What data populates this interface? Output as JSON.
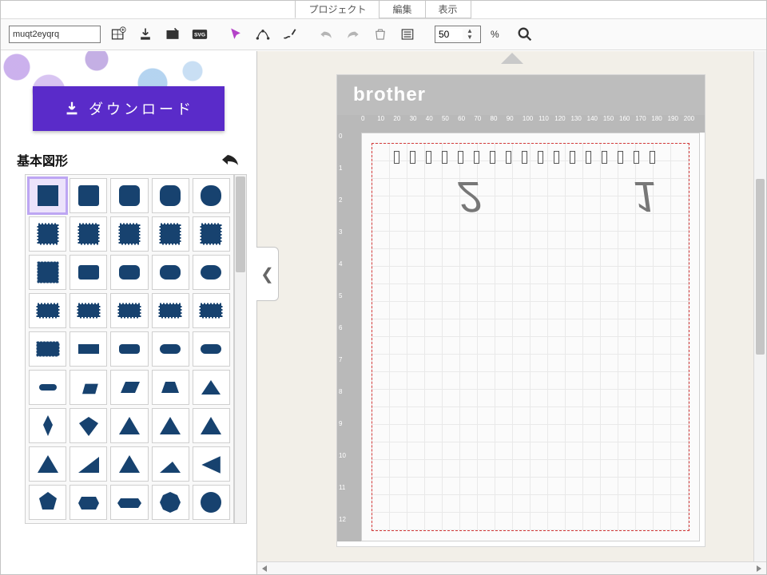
{
  "menu": {
    "project": "プロジェクト",
    "edit": "編集",
    "view": "表示"
  },
  "toolbar": {
    "searchValue": "muqt2eyqrq",
    "zoom": "50",
    "percent": "%",
    "icons": {
      "grid": "grid-plus-icon",
      "import": "import-icon",
      "image": "image-icon",
      "svg": "SVG",
      "pointer": "pointer-icon",
      "path": "path-icon",
      "draw": "draw-icon",
      "undo": "undo-icon",
      "redo": "redo-icon",
      "trash": "trash-icon",
      "panel": "panel-icon",
      "search": "search-icon"
    }
  },
  "left": {
    "download": "ダウンロード",
    "shapesTitle": "基本図形"
  },
  "mat": {
    "brand": "brother",
    "rulerTop": [
      "0",
      "10",
      "20",
      "30",
      "40",
      "50",
      "60",
      "70",
      "80",
      "90",
      "100",
      "110",
      "120",
      "130",
      "140",
      "150",
      "160",
      "170",
      "180",
      "190",
      "200"
    ],
    "rulerSide": [
      "0",
      "1",
      "2",
      "3",
      "4",
      "5",
      "6",
      "7",
      "8",
      "9",
      "10",
      "11",
      "12"
    ],
    "shapes": {
      "a": "2",
      "b": "1"
    }
  },
  "chart_data": null
}
